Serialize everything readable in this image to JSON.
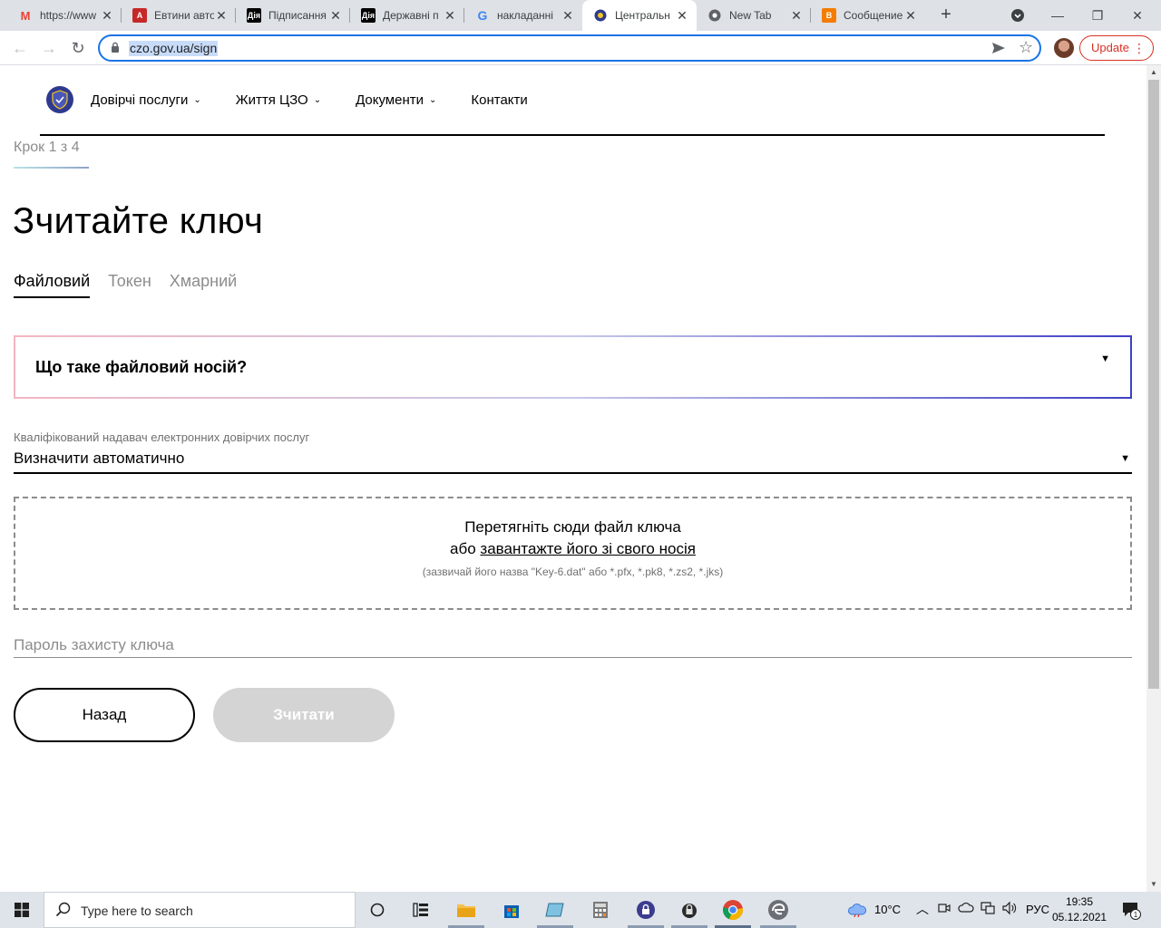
{
  "browser": {
    "tabs": [
      {
        "title": "https://www",
        "favicon": "gmail-icon",
        "active": false
      },
      {
        "title": "Евтини авто",
        "favicon": "auto-site-icon",
        "active": false
      },
      {
        "title": "Підписання",
        "favicon": "diia-icon",
        "active": false
      },
      {
        "title": "Державні п",
        "favicon": "diia-icon",
        "active": false
      },
      {
        "title": "накладанні",
        "favicon": "google-icon",
        "active": false
      },
      {
        "title": "Центральн",
        "favicon": "czo-icon",
        "active": true
      },
      {
        "title": "New Tab",
        "favicon": "chrome-icon",
        "active": false
      },
      {
        "title": "Сообщение",
        "favicon": "blogger-icon",
        "active": false
      }
    ],
    "url": "czo.gov.ua/sign",
    "update_label": "Update"
  },
  "site": {
    "nav": [
      {
        "label": "Довірчі послуги",
        "dropdown": true
      },
      {
        "label": "Життя ЦЗО",
        "dropdown": true
      },
      {
        "label": "Документи",
        "dropdown": true
      },
      {
        "label": "Контакти",
        "dropdown": false
      }
    ]
  },
  "page": {
    "step": "Крок 1 з 4",
    "title": "Зчитайте ключ",
    "tabs": [
      {
        "label": "Файловий",
        "active": true
      },
      {
        "label": "Токен",
        "active": false
      },
      {
        "label": "Хмарний",
        "active": false
      }
    ],
    "accordion_question": "Що таке файловий носій?",
    "provider_label": "Кваліфікований надавач електронних довірчих послуг",
    "provider_value": "Визначити автоматично",
    "dropzone": {
      "line1": "Перетягніть сюди файл ключа",
      "line2_prefix": "або ",
      "line2_link": "завантажте його зі свого носія",
      "hint": "(зазвичай його назва \"Key-6.dat\" або *.pfx, *.pk8, *.zs2, *.jks)"
    },
    "password_placeholder": "Пароль захисту ключа",
    "password_value": "",
    "back_button": "Назад",
    "read_button": "Зчитати",
    "read_button_enabled": false
  },
  "taskbar": {
    "search_placeholder": "Type here to search",
    "weather": "10°C",
    "language": "РУС",
    "time": "19:35",
    "date": "05.12.2021",
    "notification_count": "1",
    "apps": [
      "task-view-icon",
      "widgets-icon",
      "file-explorer-icon",
      "store-icon",
      "notes-icon",
      "calculator-icon",
      "lock-app-icon",
      "security-app-icon",
      "chrome-icon",
      "edge-legacy-icon"
    ]
  },
  "colors": {
    "accent_blue": "#1a73e8",
    "update_red": "#d93025",
    "accordion_border_end": "#3e3fc4",
    "disabled_button": "#d4d4d4"
  }
}
